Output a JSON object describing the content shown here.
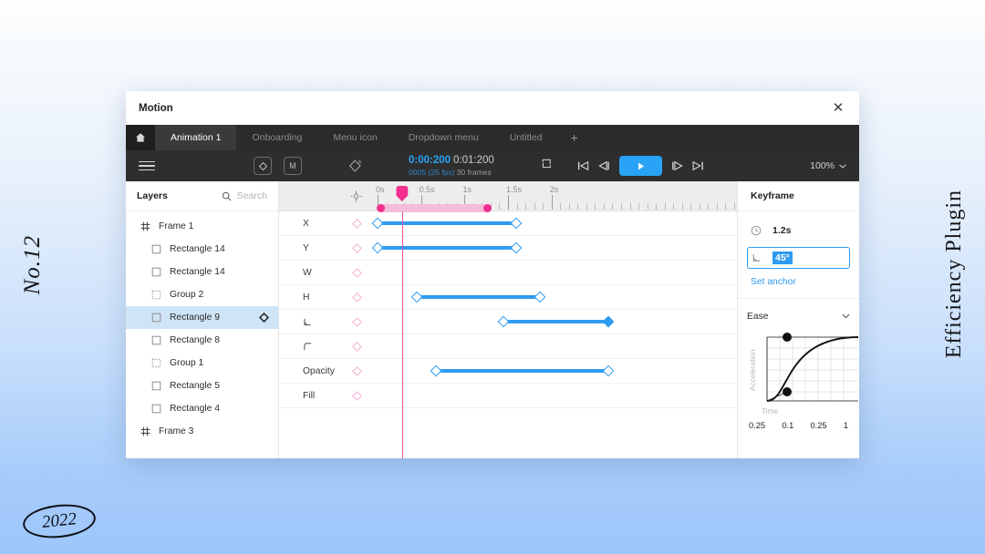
{
  "poster": {
    "issue": "No.12",
    "plugin_name": "Efficiency Plugin",
    "year": "2022"
  },
  "window": {
    "title": "Motion",
    "close_icon": "close-icon"
  },
  "tabs": {
    "home_icon": "home-icon",
    "items": [
      {
        "label": "Animation 1",
        "active": true
      },
      {
        "label": "Onboarding",
        "active": false
      },
      {
        "label": "Menu icon",
        "active": false
      },
      {
        "label": "Dropdown menu",
        "active": false
      },
      {
        "label": "Untitled",
        "active": false
      }
    ],
    "add_label": "+"
  },
  "toolbar": {
    "menu_icon": "hamburger-menu-icon",
    "keyframe_tool_label": "◇",
    "magic_tool_label": "M",
    "anchor_tool_icon": "anchor-tag-icon",
    "time_current": "0:00:200",
    "time_total": "0:01:200",
    "frame_current": "0005 (25 fps)",
    "frame_total": "30 frames",
    "loop_icon": "loop-icon",
    "prev_keyframe_icon": "skip-to-start-icon",
    "step_back_icon": "step-back-icon",
    "play_icon": "play-icon",
    "step_forward_icon": "step-forward-icon",
    "next_keyframe_icon": "skip-to-end-icon",
    "zoom_level": "100%",
    "zoom_caret": "⌄"
  },
  "layers": {
    "title": "Layers",
    "search_icon": "search-icon",
    "search_placeholder": "Search",
    "items": [
      {
        "label": "Frame 1",
        "type": "frame",
        "indent": false,
        "selected": false,
        "has_keyframe": false
      },
      {
        "label": "Rectangle 14",
        "type": "rectangle",
        "indent": true,
        "selected": false,
        "has_keyframe": false
      },
      {
        "label": "Rectangle 14",
        "type": "rectangle",
        "indent": true,
        "selected": false,
        "has_keyframe": false
      },
      {
        "label": "Group 2",
        "type": "group",
        "indent": true,
        "selected": false,
        "has_keyframe": false
      },
      {
        "label": "Rectangle 9",
        "type": "rectangle",
        "indent": true,
        "selected": true,
        "has_keyframe": true
      },
      {
        "label": "Rectangle 8",
        "type": "rectangle",
        "indent": true,
        "selected": false,
        "has_keyframe": false
      },
      {
        "label": "Group 1",
        "type": "group",
        "indent": true,
        "selected": false,
        "has_keyframe": false
      },
      {
        "label": "Rectangle 5",
        "type": "rectangle",
        "indent": true,
        "selected": false,
        "has_keyframe": false
      },
      {
        "label": "Rectangle 4",
        "type": "rectangle",
        "indent": true,
        "selected": false,
        "has_keyframe": false
      },
      {
        "label": "Frame 3",
        "type": "frame",
        "indent": false,
        "selected": false,
        "has_keyframe": false
      }
    ]
  },
  "timeline": {
    "anchor_icon": "anchor-target-icon",
    "major_ticks": [
      {
        "label": "0s",
        "pos_pct": 0
      },
      {
        "label": "0.5s",
        "pos_pct": 12.1
      },
      {
        "label": "1s",
        "pos_pct": 24.2
      },
      {
        "label": "1.5s",
        "pos_pct": 36.3
      },
      {
        "label": "2s",
        "pos_pct": 48.4
      }
    ],
    "minor_tick_step_pct": 2.42,
    "minor_tick_count": 42,
    "work_range": {
      "start_pct": 0,
      "end_pct": 31.4
    },
    "playhead_pct": 6.8,
    "rows": [
      {
        "name": "X",
        "icon": null,
        "has_keyframes": true,
        "bar": {
          "start_pct": 0,
          "end_pct": 38.5
        },
        "end_filled": false
      },
      {
        "name": "Y",
        "icon": null,
        "has_keyframes": true,
        "bar": {
          "start_pct": 0,
          "end_pct": 38.5
        },
        "end_filled": false
      },
      {
        "name": "W",
        "icon": null,
        "has_keyframes": false,
        "bar": null,
        "end_filled": false
      },
      {
        "name": "H",
        "icon": null,
        "has_keyframes": true,
        "bar": {
          "start_pct": 10.8,
          "end_pct": 45.2
        },
        "end_filled": false
      },
      {
        "name": "",
        "icon": "angle-icon",
        "has_keyframes": true,
        "bar": {
          "start_pct": 35.1,
          "end_pct": 64.2
        },
        "end_filled": true
      },
      {
        "name": "",
        "icon": "corner-radius-icon",
        "has_keyframes": false,
        "bar": null,
        "end_filled": false
      },
      {
        "name": "Opacity",
        "icon": null,
        "has_keyframes": true,
        "bar": {
          "start_pct": 16.2,
          "end_pct": 64.2
        },
        "end_filled": false
      },
      {
        "name": "Fill",
        "icon": null,
        "has_keyframes": false,
        "bar": null,
        "end_filled": false
      }
    ]
  },
  "inspector": {
    "title": "Keyframe",
    "duration_icon": "clock-icon",
    "duration_value": "1.2s",
    "angle_icon": "angle-icon",
    "angle_value": "45°",
    "set_anchor_label": "Set anchor",
    "ease": {
      "label": "Ease",
      "caret_icon": "chevron-down-icon",
      "y_axis_label": "Acceleration",
      "x_axis_label": "Time",
      "bezier_values": [
        "0.25",
        "0.1",
        "0.25",
        "1"
      ]
    }
  },
  "colors": {
    "accent_blue": "#2f9bf0",
    "toolbar_blue": "#29a3f5",
    "playhead_pink": "#f22f8d",
    "work_range_pink": "#f5bddb",
    "selection_blue": "#cfe4f6"
  }
}
